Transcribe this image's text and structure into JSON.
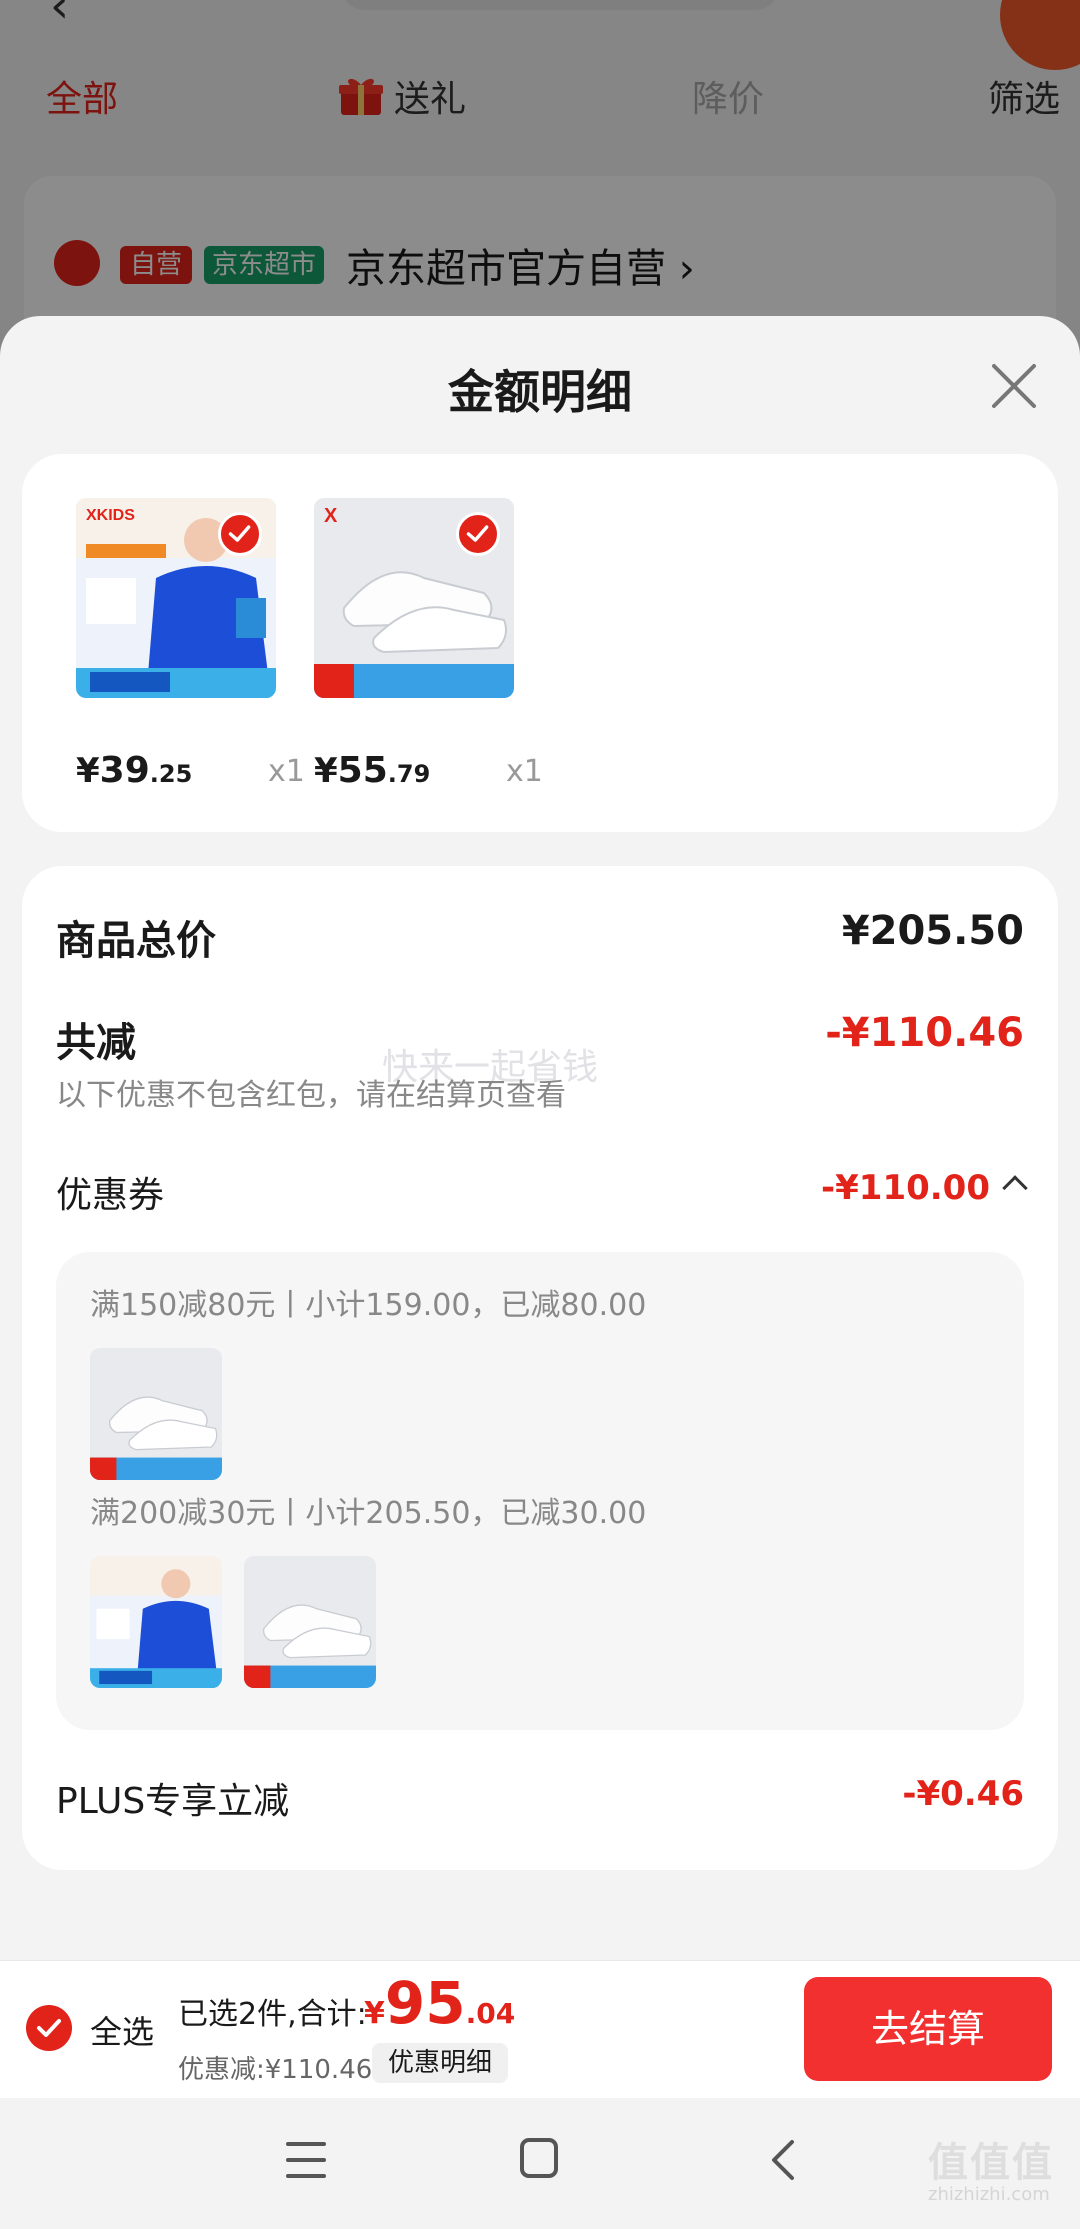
{
  "background": {
    "tabs": {
      "all": "全部",
      "gift": "送礼",
      "price_drop": "降价",
      "filter": "筛选"
    },
    "shop": {
      "badge_self": "自营",
      "badge_market": "京东超市",
      "name": "京东超市官方自营 ›"
    }
  },
  "sheet": {
    "title": "金额明细",
    "products": [
      {
        "image": "kids-blue-longsleeve-shirt",
        "price_symbol": "¥",
        "price_int": "39",
        "price_dec": ".25",
        "qty": "x1"
      },
      {
        "image": "white-sneakers",
        "price_symbol": "¥",
        "price_int": "55",
        "price_dec": ".79",
        "qty": "x1"
      }
    ],
    "summary": {
      "total_label": "商品总价",
      "total_value": "¥205.50",
      "discount_label": "共减",
      "discount_value": "-¥110.46",
      "discount_note": "以下优惠不包含红包，请在结算页查看",
      "watermark": "快来一起省钱",
      "coupon_label": "优惠券",
      "coupon_value": "-¥110.00",
      "coupon_rules": [
        {
          "text": "满150减80元丨小计159.00，已减80.00",
          "items": [
            "white-sneakers"
          ]
        },
        {
          "text": "满200减30元丨小计205.50，已减30.00",
          "items": [
            "kids-blue-longsleeve-shirt",
            "white-sneakers"
          ]
        }
      ],
      "plus_label": "PLUS专享立减",
      "plus_value": "-¥0.46"
    }
  },
  "bottom_bar": {
    "select_all": "全选",
    "selected_text": "已选2件,合计:",
    "total_symbol": "¥",
    "total_int": "95",
    "total_dec": ".04",
    "discount_text": "优惠减:¥110.46",
    "detail_button": "优惠明细",
    "checkout_button": "去结算"
  },
  "watermark_corner": {
    "text": "值值值",
    "url": "zhizhizhi.com"
  },
  "colors": {
    "accent": "#e2231a",
    "checkout": "#f23030",
    "market_badge": "#1aa06b"
  }
}
